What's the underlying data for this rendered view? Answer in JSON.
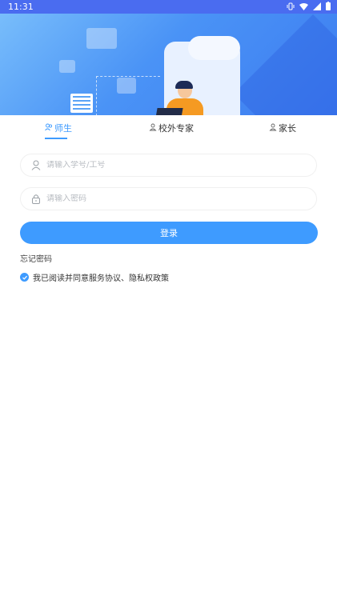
{
  "status_bar": {
    "time": "11:31",
    "icons": [
      "vibrate-icon",
      "wifi-icon",
      "signal-icon",
      "battery-icon"
    ]
  },
  "tabs": [
    {
      "label": "师生",
      "icon": "user-group-icon",
      "active": true
    },
    {
      "label": "校外专家",
      "icon": "user-icon",
      "active": false
    },
    {
      "label": "家长",
      "icon": "user-icon",
      "active": false
    }
  ],
  "form": {
    "username_placeholder": "请输入学号/工号",
    "password_placeholder": "请输入密码",
    "login_label": "登录",
    "forgot_label": "忘记密码",
    "agreement_label": "我已阅读并同意服务协议、隐私权政策",
    "agreement_checked": true
  },
  "colors": {
    "accent": "#3e9bff",
    "status_bar": "#4a6cf0"
  }
}
